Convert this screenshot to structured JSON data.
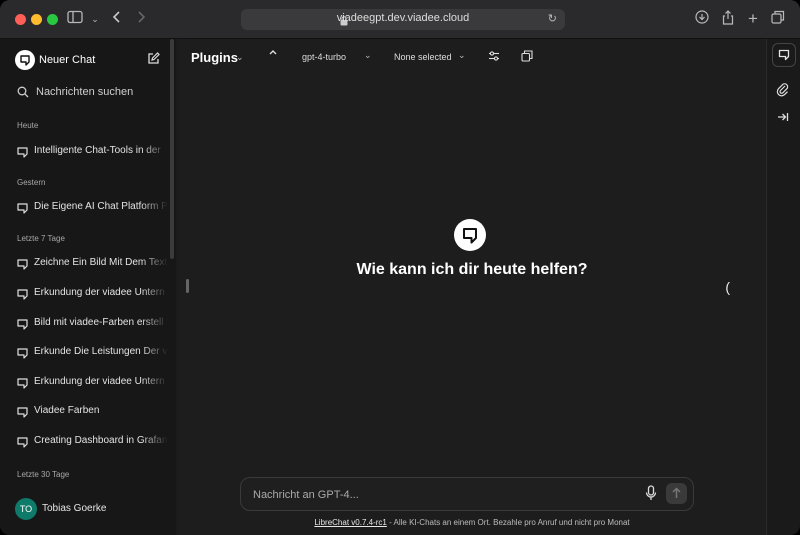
{
  "browser": {
    "url": "viadeegpt.dev.viadee.cloud"
  },
  "sidebar": {
    "new_chat_label": "Neuer Chat",
    "search_placeholder": "Nachrichten suchen",
    "groups": [
      {
        "label": "Heute",
        "items": [
          "Intelligente Chat-Tools in der"
        ]
      },
      {
        "label": "Gestern",
        "items": [
          "Die Eigene AI Chat Platform P"
        ]
      },
      {
        "label": "Letzte 7 Tage",
        "items": [
          "Zeichne Ein Bild Mit Dem Text",
          "Erkundung der viadee Untern",
          "Bild mit viadee-Farben erstell",
          "Erkunde Die Leistungen Der v",
          "Erkundung der viadee Untern",
          "Viadee Farben",
          "Creating Dashboard in Grafan"
        ]
      },
      {
        "label": "Letzte 30 Tage",
        "items": []
      }
    ],
    "user": {
      "initials": "TO",
      "name": "Tobias Goerke"
    }
  },
  "header": {
    "endpoint": "Plugins",
    "model": "gpt-4-turbo",
    "plugins": "None selected"
  },
  "main": {
    "greeting": "Wie kann ich dir heute helfen?"
  },
  "composer": {
    "placeholder": "Nachricht an GPT-4..."
  },
  "footer": {
    "link": "LibreChat v0.7.4-rc1",
    "text": " - Alle KI-Chats an einem Ort. Bezahle pro Anruf und nicht pro Monat"
  },
  "colors": {
    "avatar": "#0e7a6a",
    "close": "#ff5f57",
    "minimize": "#febc2e",
    "zoom": "#28c840"
  }
}
